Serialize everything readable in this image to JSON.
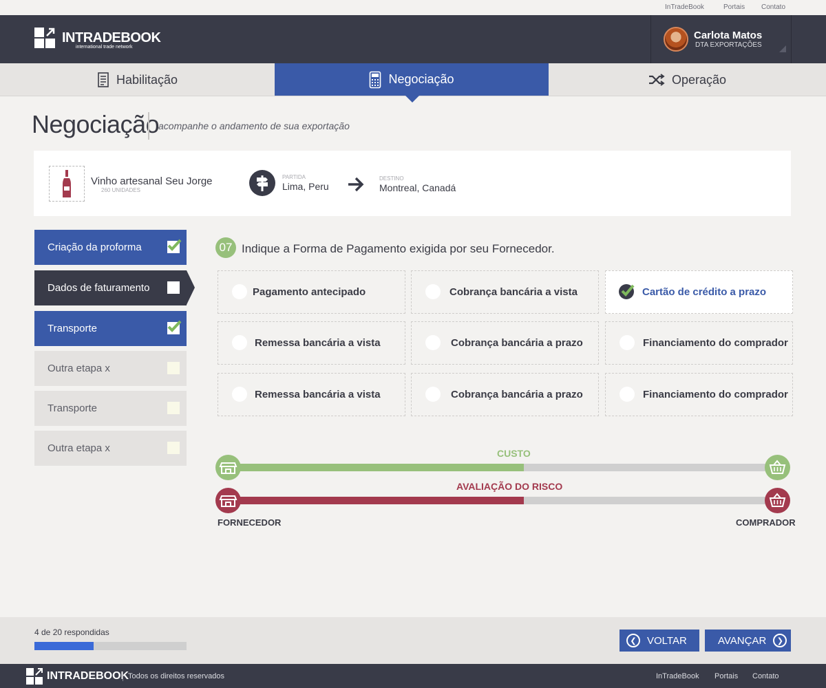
{
  "top_links": [
    "InTradeBook",
    "Portais",
    "Contato"
  ],
  "brand": {
    "name": "INTRADEBOOK",
    "tagline": "international trade network"
  },
  "user": {
    "name": "Carlota Matos",
    "role": "DTA EXPORTAÇÕES"
  },
  "tabs": [
    {
      "label": "Habilitação",
      "icon": "document-list-icon"
    },
    {
      "label": "Negociação",
      "icon": "calculator-icon",
      "active": true
    },
    {
      "label": "Operação",
      "icon": "shuffle-icon"
    }
  ],
  "page": {
    "title": "Negociação",
    "subtitle": "acompanhe o andamento de sua exportação"
  },
  "product": {
    "name": "Vinho artesanal Seu Jorge",
    "quantity": "260 UNIDADES",
    "origin_label": "PARTIDA",
    "origin": "Lima, Peru",
    "destination_label": "DESTINO",
    "destination": "Montreal, Canadá"
  },
  "steps": [
    {
      "label": "Criação da proforma",
      "state": "done"
    },
    {
      "label": "Dados de faturamento",
      "state": "current"
    },
    {
      "label": "Transporte",
      "state": "done"
    },
    {
      "label": "Outra etapa x",
      "state": "todo"
    },
    {
      "label": "Transporte",
      "state": "todo"
    },
    {
      "label": "Outra etapa x",
      "state": "todo"
    }
  ],
  "question": {
    "number": "07",
    "text": "Indique a Forma de Pagamento exigida por seu Fornecedor.",
    "options": [
      {
        "label": "Pagamento antecipado",
        "selected": false
      },
      {
        "label": "Cobrança bancária a vista",
        "selected": false
      },
      {
        "label": "Cartão de crédito a prazo",
        "selected": true
      },
      {
        "label": "Remessa bancária a vista",
        "selected": false
      },
      {
        "label": "Cobrança bancária a prazo",
        "selected": false
      },
      {
        "label": "Financiamento do comprador",
        "selected": false
      },
      {
        "label": "Remessa bancária a vista",
        "selected": false
      },
      {
        "label": "Cobrança bancária a prazo",
        "selected": false
      },
      {
        "label": "Financiamento do comprador",
        "selected": false
      }
    ]
  },
  "balance": {
    "cost_label": "CUSTO",
    "cost_level": 0.54,
    "risk_label": "AVALIAÇÃO DO RISCO",
    "risk_level": 0.54,
    "left_label": "FORNECEDOR",
    "right_label": "COMPRADOR"
  },
  "progress": {
    "text": "4 de 20 respondidas",
    "fraction": 0.2
  },
  "buttons": {
    "back": "VOLTAR",
    "next": "AVANÇAR"
  },
  "footer": {
    "brand": "INTRADEBOOK",
    "rights": "Todos os direitos reservados",
    "links": [
      "InTradeBook",
      "Portais",
      "Contato"
    ]
  },
  "colors": {
    "primary": "#3a5aa8",
    "dark": "#393b48",
    "green": "#97c07b",
    "red": "#a33a4e"
  }
}
